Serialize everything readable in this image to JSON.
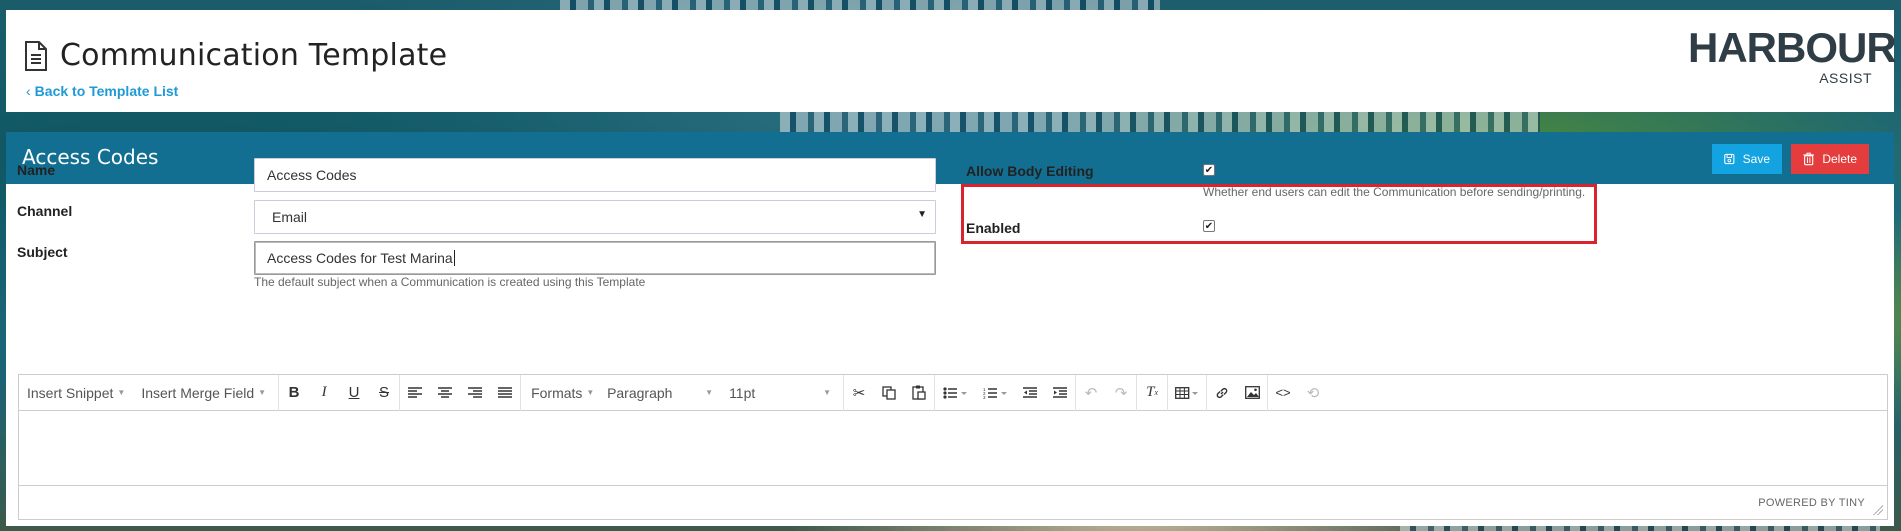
{
  "page": {
    "title": "Communication Template",
    "back_link": "Back to Template List",
    "logo_word": "HARBOUR",
    "logo_sub": "ASSIST"
  },
  "panel": {
    "title": "Access Codes",
    "save_label": "Save",
    "delete_label": "Delete"
  },
  "form": {
    "name_label": "Name",
    "name_value": "Access Codes",
    "channel_label": "Channel",
    "channel_value": "Email",
    "subject_label": "Subject",
    "subject_value": "Access Codes for Test Marina",
    "subject_help": "The default subject when a Communication is created using this Template",
    "allow_body_label": "Allow Body Editing",
    "allow_body_checked": true,
    "allow_body_help": "Whether end users can edit the Communication before sending/printing.",
    "enabled_label": "Enabled",
    "enabled_checked": true
  },
  "editor": {
    "insert_snippet": "Insert Snippet",
    "insert_merge_field": "Insert Merge Field",
    "formats": "Formats",
    "paragraph": "Paragraph",
    "font_size": "11pt",
    "powered_by": "POWERED BY TINY"
  },
  "colors": {
    "header_bar": "#136f91",
    "save_button": "#12a3e0",
    "delete_button": "#e53d3d",
    "link": "#1e9ad6",
    "highlight": "#d9242e"
  }
}
